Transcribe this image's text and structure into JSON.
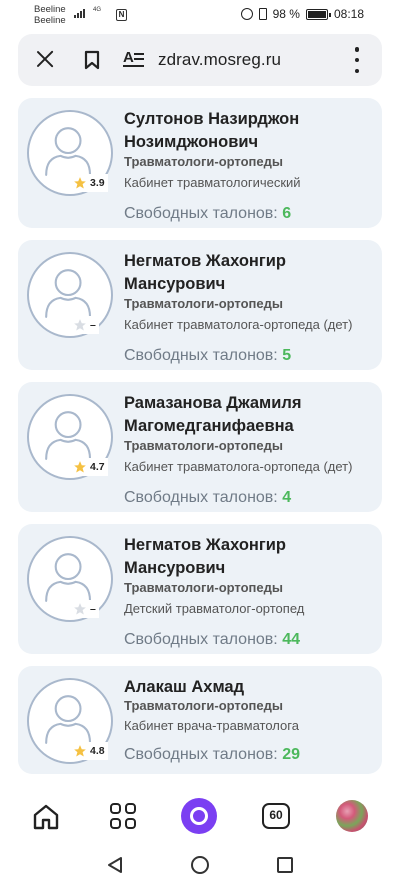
{
  "status_bar": {
    "carrier_1": "Beeline",
    "carrier_2": "Beeline",
    "network": "4G",
    "battery": "98 %",
    "battery_level": 0.98,
    "time": "08:18"
  },
  "browser": {
    "url": "zdrav.mosreg.ru",
    "reader_icon": "reader-mode-icon",
    "close_icon": "close-icon",
    "bookmark_icon": "bookmark-icon",
    "menu_icon": "more-vertical-icon"
  },
  "doctors": [
    {
      "name": "Султонов Назирджон Нозимджонович",
      "specialty": "Травматологи-ортопеды",
      "room": "Кабинет травматологический",
      "rating": "3.9",
      "rated": true,
      "free_label": "Свободных талонов:",
      "free_count": "6"
    },
    {
      "name": "Негматов Жахонгир Мансурович",
      "specialty": "Травматологи-ортопеды",
      "room": "Кабинет травматолога-ортопеда (дет)",
      "rating": "–",
      "rated": false,
      "free_label": "Свободных талонов:",
      "free_count": "5"
    },
    {
      "name": "Рамазанова Джамиля Магомедганифаевна",
      "specialty": "Травматологи-ортопеды",
      "room": "Кабинет травматолога-ортопеда (дет)",
      "rating": "4.7",
      "rated": true,
      "free_label": "Свободных талонов:",
      "free_count": "4"
    },
    {
      "name": "Негматов Жахонгир Мансурович",
      "specialty": "Травматологи-ортопеды",
      "room": "Детский травматолог-ортопед",
      "rating": "–",
      "rated": false,
      "free_label": "Свободных талонов:",
      "free_count": "44"
    },
    {
      "name": "Алакаш Ахмад",
      "specialty": "Травматологи-ортопеды",
      "room": "Кабинет врача-травматолога",
      "rating": "4.8",
      "rated": true,
      "free_label": "Свободных талонов:",
      "free_count": "29"
    }
  ],
  "bottom_nav": {
    "tabs_count": "60",
    "items": [
      "home-icon",
      "apps-icon",
      "alice-icon",
      "tabs-icon",
      "profile-avatar"
    ]
  },
  "colors": {
    "card_bg": "#edf2f7",
    "free_count": "#4cb85c",
    "star_filled": "#f5c142",
    "star_empty": "#d9dde3",
    "alice": "#7b3ff2"
  }
}
